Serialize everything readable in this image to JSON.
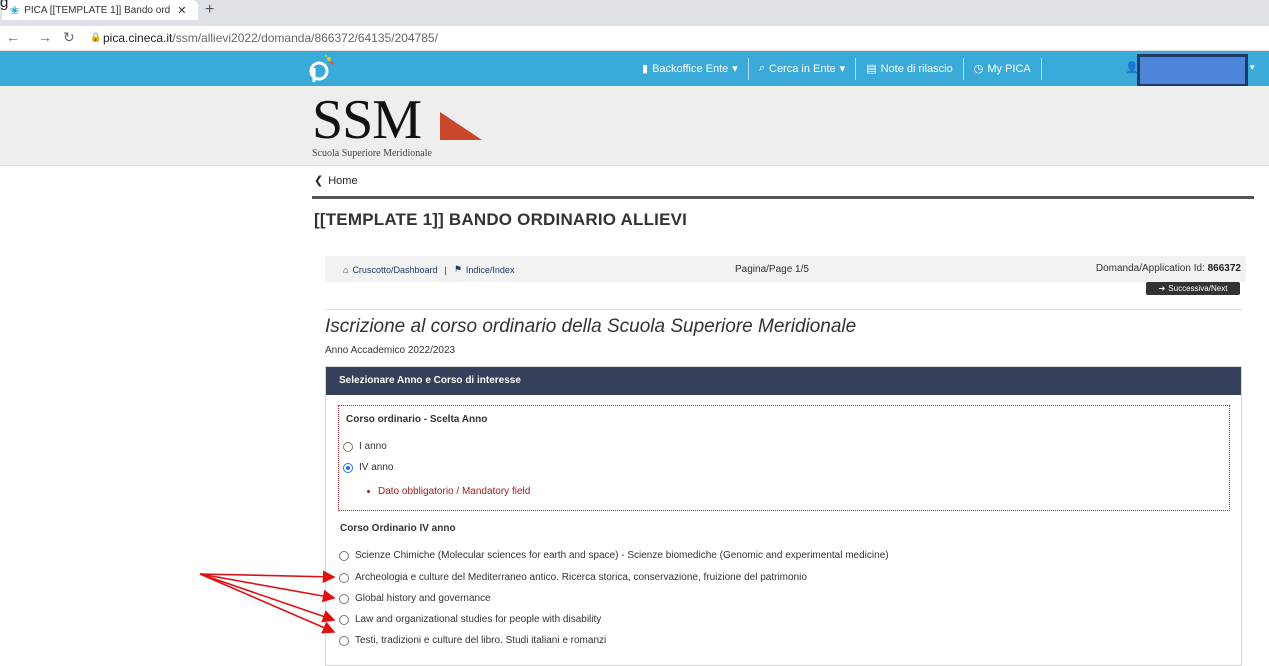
{
  "browser": {
    "top_fragment": "g",
    "tab_title": "PICA [[TEMPLATE 1]] Bando ordi",
    "tab_close": "✕",
    "new_tab": "+",
    "url_host": "pica.cineca.it",
    "url_path": "/ssm/allievi2022/domanda/866372/64135/204785/"
  },
  "navbar": {
    "items": [
      {
        "icon": "bar-chart-icon",
        "label": "Backoffice Ente",
        "caret": "▾"
      },
      {
        "icon": "search-icon",
        "label": "Cerca in Ente",
        "caret": "▾"
      },
      {
        "icon": "list-icon",
        "label": "Note di rilascio",
        "caret": ""
      },
      {
        "icon": "clock-icon",
        "label": "My PICA",
        "caret": ""
      }
    ]
  },
  "header": {
    "logo_text": "SSM",
    "logo_subtitle": "Scuola Superiore Meridionale"
  },
  "breadcrumb": {
    "home_label": "Home"
  },
  "page_title": "[[TEMPLATE 1]] BANDO ORDINARIO ALLIEVI",
  "toolbar": {
    "dashboard_label": "Cruscotto/Dashboard",
    "separator": "|",
    "index_label": "Indice/Index",
    "page_label": "Pagina/Page 1/5",
    "application_label": "Domanda/Application Id:",
    "application_id": "866372",
    "next_label": "Successiva/Next"
  },
  "form": {
    "heading": "Iscrizione al corso ordinario della Scuola Superiore Meridionale",
    "academic_year": "Anno Accademico 2022/2023",
    "panel_title": "Selezionare Anno e Corso di interesse",
    "year_section": {
      "title": "Corso ordinario - Scelta Anno",
      "options": [
        {
          "label": "I anno",
          "checked": false
        },
        {
          "label": "IV anno",
          "checked": true
        }
      ],
      "error": "Dato obbligatorio / Mandatory field"
    },
    "course_section": {
      "title": "Corso Ordinario IV anno",
      "options": [
        {
          "label": "Scienze Chimiche (Molecular sciences for earth and space) - Scienze biomediche (Genomic and experimental medicine)",
          "checked": false
        },
        {
          "label": "Archeologia e culture del Mediterraneo antico. Ricerca storica, conservazione, fruizione del patrimonio",
          "checked": false
        },
        {
          "label": "Global history and governance",
          "checked": false
        },
        {
          "label": "Law and organizational studies for people with disability",
          "checked": false
        },
        {
          "label": "Testi, tradizioni e culture del libro. Studi italiani e romanzi",
          "checked": false
        }
      ]
    }
  },
  "colors": {
    "navbar": "#3aaad8",
    "panel_header": "#37405a",
    "error": "#a02020",
    "annotation_arrow": "#e01010"
  }
}
